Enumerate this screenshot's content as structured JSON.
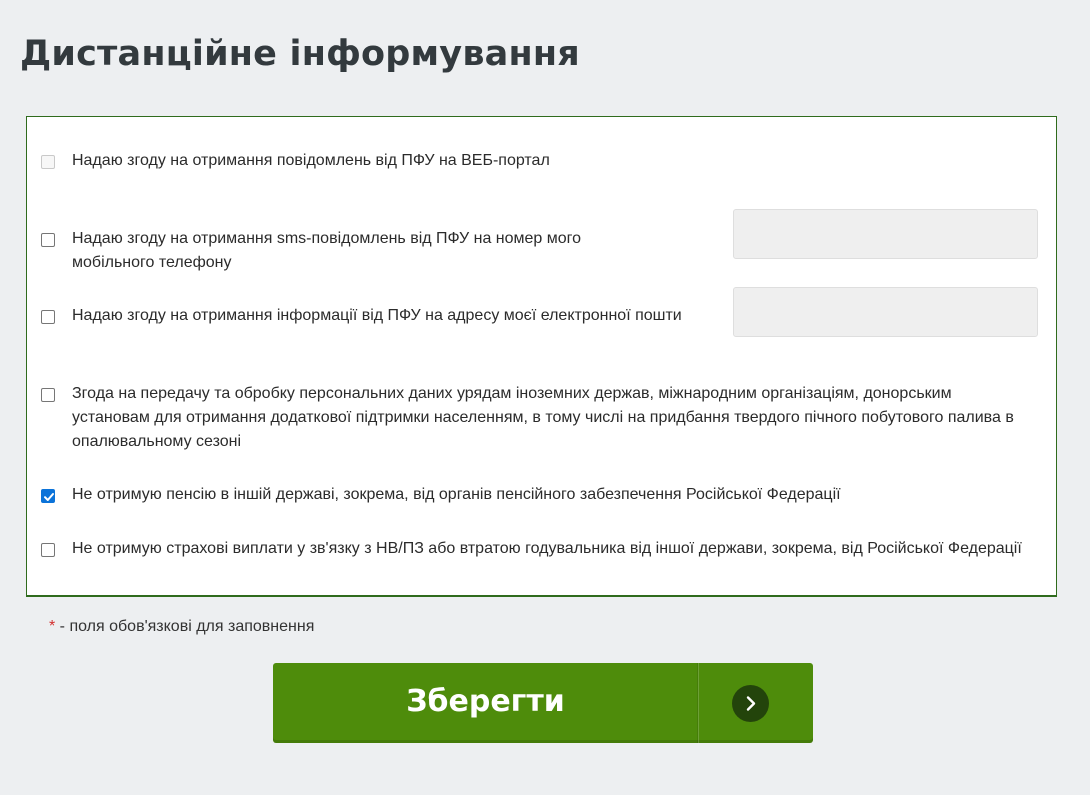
{
  "page": {
    "title": "Дистанційне інформування"
  },
  "consents": [
    {
      "label": "Надаю згоду на отримання повідомлень від ПФУ на ВЕБ-портал",
      "checked": false,
      "disabled": true
    },
    {
      "label": "Надаю згоду на отримання sms-повідомлень від ПФУ на номер мого мобільного телефону",
      "checked": false,
      "disabled": false,
      "input_value": ""
    },
    {
      "label": "Надаю згоду на отримання інформації від ПФУ на адресу моєї електронної пошти",
      "checked": false,
      "disabled": false,
      "input_value": ""
    },
    {
      "label": "Згода на передачу та обробку персональних даних урядам іноземних держав, міжнародним організаціям, донорським установам для отримання додаткової підтримки населенням, в тому числі на придбання твердого пічного побутового палива в опалювальному сезоні",
      "checked": false,
      "disabled": false
    },
    {
      "label": "Не отримую пенсію в іншій державі, зокрема, від органів пенсійного забезпечення Російської Федерації",
      "checked": true,
      "disabled": false
    },
    {
      "label": "Не отримую страхові виплати у зв'язку з НВ/ПЗ або втратою годувальника від іншої держави, зокрема, від Російської Федерації",
      "checked": false,
      "disabled": false
    }
  ],
  "required_note": {
    "star": "*",
    "text": " - поля обов'язкові для заповнення"
  },
  "save_button": {
    "label": "Зберегти",
    "icon": "chevron-right-icon"
  },
  "colors": {
    "panel_border": "#2f6b1d",
    "button": "#4e8c0b",
    "button_icon_bg": "#23440b",
    "checkbox_checked": "#0b73d9",
    "required_star": "#d32f2f"
  }
}
